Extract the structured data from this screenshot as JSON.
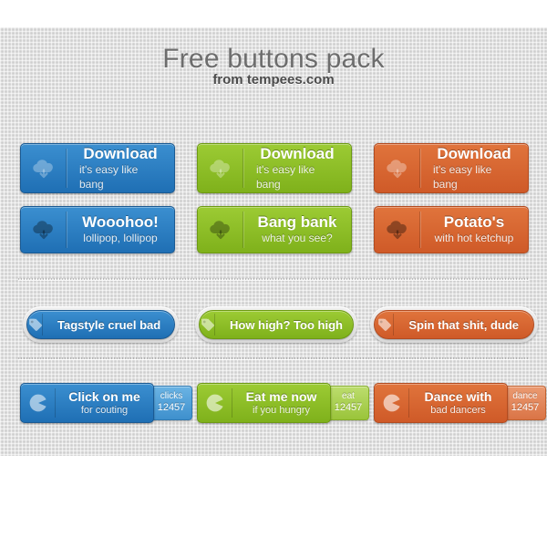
{
  "header": {
    "title": "Free buttons pack",
    "subtitle": "from tempees.com"
  },
  "colors": {
    "blue": "#2a7cbf",
    "green": "#8dbe27",
    "orange": "#d76231",
    "canvas": "#dcdcdc",
    "title_text": "#6d6d6d",
    "subtitle_text": "#4b4b4b"
  },
  "rows": {
    "download": [
      {
        "color": "blue",
        "icon": "cloud-download-icon",
        "title": "Download",
        "subtitle": "it's easy like bang"
      },
      {
        "color": "green",
        "icon": "cloud-download-icon",
        "title": "Download",
        "subtitle": "it's easy like bang"
      },
      {
        "color": "orange",
        "icon": "cloud-download-icon",
        "title": "Download",
        "subtitle": "it's easy like bang"
      }
    ],
    "fun": [
      {
        "color": "blue",
        "icon": "cloud-download-icon",
        "title": "Wooohoo!",
        "subtitle": "lollipop, lollipop"
      },
      {
        "color": "green",
        "icon": "cloud-download-icon",
        "title": "Bang bank",
        "subtitle": "what you see?"
      },
      {
        "color": "orange",
        "icon": "cloud-download-icon",
        "title": "Potato's",
        "subtitle": "with hot ketchup"
      }
    ],
    "tags": [
      {
        "color": "blue",
        "icon": "tag-icon",
        "label": "Tagstyle cruel bad"
      },
      {
        "color": "green",
        "icon": "tag-icon",
        "label": "How high? Too high"
      },
      {
        "color": "orange",
        "icon": "tag-icon",
        "label": "Spin that shit, dude"
      }
    ],
    "counters": [
      {
        "color": "blue",
        "icon": "pacman-icon",
        "title": "Click on me",
        "subtitle": "for couting",
        "counter_label": "clicks",
        "counter_value": "12457"
      },
      {
        "color": "green",
        "icon": "pacman-icon",
        "title": "Eat me now",
        "subtitle": "if you hungry",
        "counter_label": "eat",
        "counter_value": "12457"
      },
      {
        "color": "orange",
        "icon": "pacman-icon",
        "title": "Dance with",
        "subtitle": "bad dancers",
        "counter_label": "dance",
        "counter_value": "12457"
      }
    ]
  }
}
